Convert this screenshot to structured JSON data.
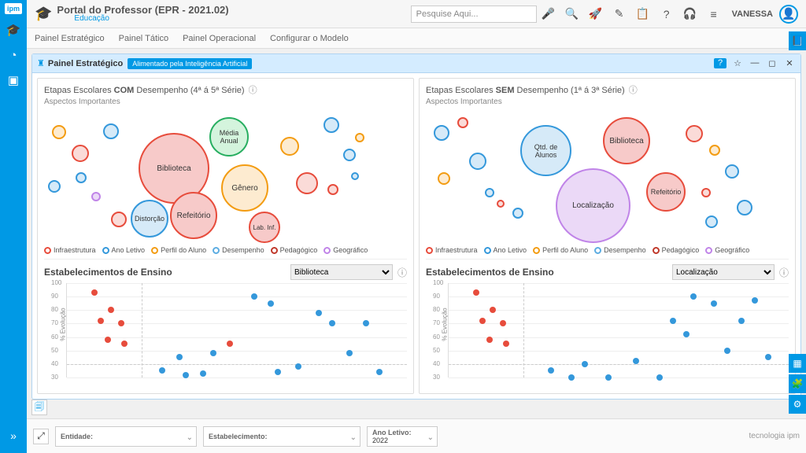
{
  "header": {
    "title": "Portal do Professor (EPR - 2021.02)",
    "subtitle": "Educação",
    "search_placeholder": "Pesquise Aqui...",
    "user": "VANESSA"
  },
  "subnav": [
    "Painel Estratégico",
    "Painel Tático",
    "Painel Operacional",
    "Configurar o Modelo"
  ],
  "panel": {
    "title": "Painel Estratégico",
    "badge": "Alimentado pela Inteligência Artificial"
  },
  "left_col": {
    "title_prefix": "Etapas Escolares ",
    "title_bold": "COM",
    "title_suffix": " Desempenho (4ª á 5ª Série)",
    "subtitle": "Aspectos Importantes",
    "chart2_title": "Estabelecimentos de Ensino",
    "chart2_select": "Biblioteca"
  },
  "right_col": {
    "title_prefix": "Etapas Escolares ",
    "title_bold": "SEM",
    "title_suffix": " Desempenho (1ª á 3ª Série)",
    "subtitle": "Aspectos Importantes",
    "chart2_title": "Estabelecimentos de Ensino",
    "chart2_select": "Localização"
  },
  "legend": {
    "infra": "Infraestrutura",
    "ano": "Ano Letivo",
    "perfil": "Perfil do Aluno",
    "desemp": "Desempenho",
    "pedag": "Pedagógico",
    "geo": "Geográfico"
  },
  "colors": {
    "red": "#e74c3c",
    "blue": "#3498db",
    "orange": "#f39c12",
    "green": "#27ae60",
    "purple": "#c084e8",
    "pink": "#f7cac9",
    "lblue": "#aed6f1"
  },
  "bottom": {
    "entidade": "Entidade:",
    "estabelecimento": "Estabelecimento:",
    "ano_letivo_label": "Ano Letivo:",
    "ano_letivo_value": "2022",
    "brand": "tecnologia ipm"
  },
  "scatter_ylabel": "% Evolução",
  "chart_data": [
    {
      "type": "bubble",
      "title": "Etapas Escolares COM Desempenho (4ª á 5ª Série) — Aspectos Importantes",
      "legend": [
        "Infraestrutura",
        "Ano Letivo",
        "Perfil do Aluno",
        "Desempenho",
        "Pedagógico",
        "Geográfico"
      ],
      "bubbles": [
        {
          "label": "Biblioteca",
          "size": 85,
          "category": "Infraestrutura"
        },
        {
          "label": "Média Anual",
          "size": 45,
          "category": "Desempenho"
        },
        {
          "label": "Gênero",
          "size": 55,
          "category": "Perfil do Aluno"
        },
        {
          "label": "Refeitório",
          "size": 55,
          "category": "Infraestrutura"
        },
        {
          "label": "Distorção",
          "size": 40,
          "category": "Ano Letivo"
        },
        {
          "label": "Lab. Inf.",
          "size": 35,
          "category": "Infraestrutura"
        }
      ]
    },
    {
      "type": "bubble",
      "title": "Etapas Escolares SEM Desempenho (1ª á 3ª Série) — Aspectos Importantes",
      "legend": [
        "Infraestrutura",
        "Ano Letivo",
        "Perfil do Aluno",
        "Desempenho",
        "Pedagógico",
        "Geográfico"
      ],
      "bubbles": [
        {
          "label": "Localização",
          "size": 90,
          "category": "Geográfico"
        },
        {
          "label": "Qtd. de Alunos",
          "size": 60,
          "category": "Ano Letivo"
        },
        {
          "label": "Biblioteca",
          "size": 55,
          "category": "Infraestrutura"
        },
        {
          "label": "Refeitório",
          "size": 45,
          "category": "Infraestrutura"
        }
      ]
    },
    {
      "type": "scatter",
      "title": "Estabelecimentos de Ensino — Biblioteca",
      "ylabel": "% Evolução",
      "ylim": [
        30,
        100
      ],
      "points": [
        {
          "x": 8,
          "y": 93,
          "c": "red"
        },
        {
          "x": 13,
          "y": 80,
          "c": "red"
        },
        {
          "x": 10,
          "y": 72,
          "c": "red"
        },
        {
          "x": 16,
          "y": 70,
          "c": "red"
        },
        {
          "x": 12,
          "y": 58,
          "c": "red"
        },
        {
          "x": 17,
          "y": 55,
          "c": "red"
        },
        {
          "x": 28,
          "y": 35,
          "c": "blue"
        },
        {
          "x": 33,
          "y": 45,
          "c": "blue"
        },
        {
          "x": 35,
          "y": 32,
          "c": "blue"
        },
        {
          "x": 40,
          "y": 33,
          "c": "blue"
        },
        {
          "x": 43,
          "y": 48,
          "c": "blue"
        },
        {
          "x": 48,
          "y": 55,
          "c": "red"
        },
        {
          "x": 55,
          "y": 90,
          "c": "blue"
        },
        {
          "x": 60,
          "y": 85,
          "c": "blue"
        },
        {
          "x": 62,
          "y": 34,
          "c": "blue"
        },
        {
          "x": 68,
          "y": 38,
          "c": "blue"
        },
        {
          "x": 74,
          "y": 78,
          "c": "blue"
        },
        {
          "x": 78,
          "y": 70,
          "c": "blue"
        },
        {
          "x": 83,
          "y": 48,
          "c": "blue"
        },
        {
          "x": 88,
          "y": 70,
          "c": "blue"
        },
        {
          "x": 92,
          "y": 34,
          "c": "blue"
        }
      ]
    },
    {
      "type": "scatter",
      "title": "Estabelecimentos de Ensino — Localização",
      "ylabel": "% Evolução",
      "ylim": [
        30,
        100
      ],
      "points": [
        {
          "x": 8,
          "y": 93,
          "c": "red"
        },
        {
          "x": 13,
          "y": 80,
          "c": "red"
        },
        {
          "x": 10,
          "y": 72,
          "c": "red"
        },
        {
          "x": 16,
          "y": 70,
          "c": "red"
        },
        {
          "x": 12,
          "y": 58,
          "c": "red"
        },
        {
          "x": 17,
          "y": 55,
          "c": "red"
        },
        {
          "x": 30,
          "y": 35,
          "c": "blue"
        },
        {
          "x": 36,
          "y": 30,
          "c": "blue"
        },
        {
          "x": 40,
          "y": 40,
          "c": "blue"
        },
        {
          "x": 47,
          "y": 30,
          "c": "blue"
        },
        {
          "x": 55,
          "y": 42,
          "c": "blue"
        },
        {
          "x": 62,
          "y": 30,
          "c": "blue"
        },
        {
          "x": 66,
          "y": 72,
          "c": "blue"
        },
        {
          "x": 70,
          "y": 62,
          "c": "blue"
        },
        {
          "x": 72,
          "y": 90,
          "c": "blue"
        },
        {
          "x": 78,
          "y": 85,
          "c": "blue"
        },
        {
          "x": 82,
          "y": 50,
          "c": "blue"
        },
        {
          "x": 86,
          "y": 72,
          "c": "blue"
        },
        {
          "x": 90,
          "y": 87,
          "c": "blue"
        },
        {
          "x": 94,
          "y": 45,
          "c": "blue"
        }
      ]
    }
  ]
}
